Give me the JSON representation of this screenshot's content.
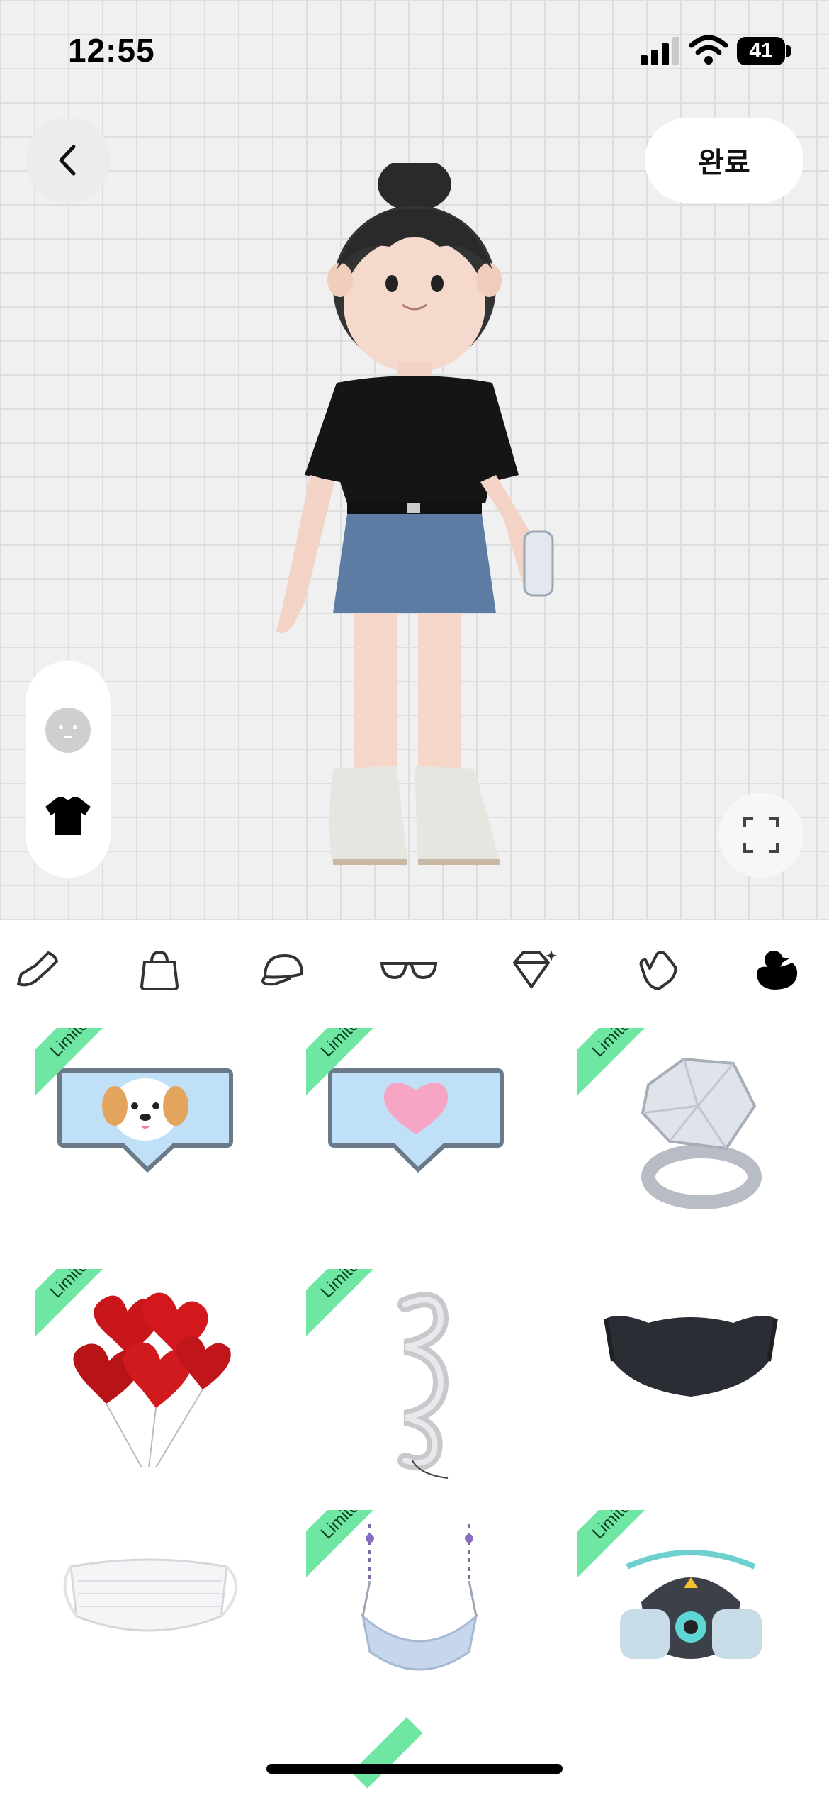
{
  "status_bar": {
    "time": "12:55",
    "battery": "41"
  },
  "header": {
    "done_label": "완료"
  },
  "categories": [
    {
      "name": "shoes-icon"
    },
    {
      "name": "bag-icon"
    },
    {
      "name": "cap-icon"
    },
    {
      "name": "glasses-icon"
    },
    {
      "name": "gem-icon"
    },
    {
      "name": "glove-icon"
    },
    {
      "name": "duck-icon",
      "selected": true
    }
  ],
  "items": [
    {
      "name": "dog-speech-bubble",
      "badge": "Limited free trial"
    },
    {
      "name": "heart-speech-bubble",
      "badge": "Limited free trial"
    },
    {
      "name": "diamond-ring",
      "badge": "Limited free trial"
    },
    {
      "name": "heart-balloons",
      "badge": "Limited free trial"
    },
    {
      "name": "2023-balloon",
      "badge": "Limited free trial"
    },
    {
      "name": "black-mask",
      "badge": ""
    },
    {
      "name": "white-mask",
      "badge": ""
    },
    {
      "name": "hanging-mask",
      "badge": "Limited free trial"
    },
    {
      "name": "gas-mask",
      "badge": "Limited free trial"
    }
  ],
  "colors": {
    "accent_ribbon": "#6fe6a2",
    "stage_bg": "#f0f0f0"
  }
}
